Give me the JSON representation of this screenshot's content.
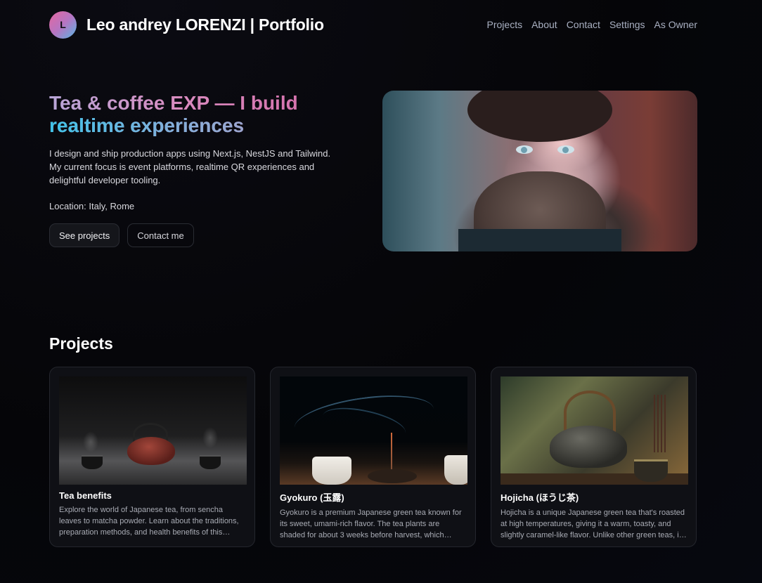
{
  "header": {
    "avatar_initial": "L",
    "brand_title": "Leo andrey LORENZI | Portfolio",
    "nav": [
      "Projects",
      "About",
      "Contact",
      "Settings",
      "As Owner"
    ]
  },
  "hero": {
    "title_line1": "Tea & coffee EXP — I build",
    "title_line2": "realtime experiences",
    "description": "I design and ship production apps using Next.js, NestJS and Tailwind. My current focus is event platforms, realtime QR experiences and delightful developer tooling.",
    "location": "Location: Italy, Rome",
    "primary_button": "See projects",
    "secondary_button": "Contact me"
  },
  "projects": {
    "section_title": "Projects",
    "items": [
      {
        "title": "Tea benefits",
        "description": "Explore the world of Japanese tea, from sencha leaves to matcha powder. Learn about the traditions, preparation methods, and health benefits of this…"
      },
      {
        "title": "Gyokuro (玉露)",
        "description": "Gyokuro is a premium Japanese green tea known for its sweet, umami-rich flavor. The tea plants are shaded for about 3 weeks before harvest, which…"
      },
      {
        "title": "Hojicha (ほうじ茶)",
        "description": "Hojicha is a unique Japanese green tea that's roasted at high temperatures, giving it a warm, toasty, and slightly caramel-like flavor. Unlike other green teas, i…"
      }
    ]
  },
  "colors": {
    "accent_pink": "#d46aa7",
    "accent_blue": "#3fc3e8",
    "background": "#050508"
  }
}
